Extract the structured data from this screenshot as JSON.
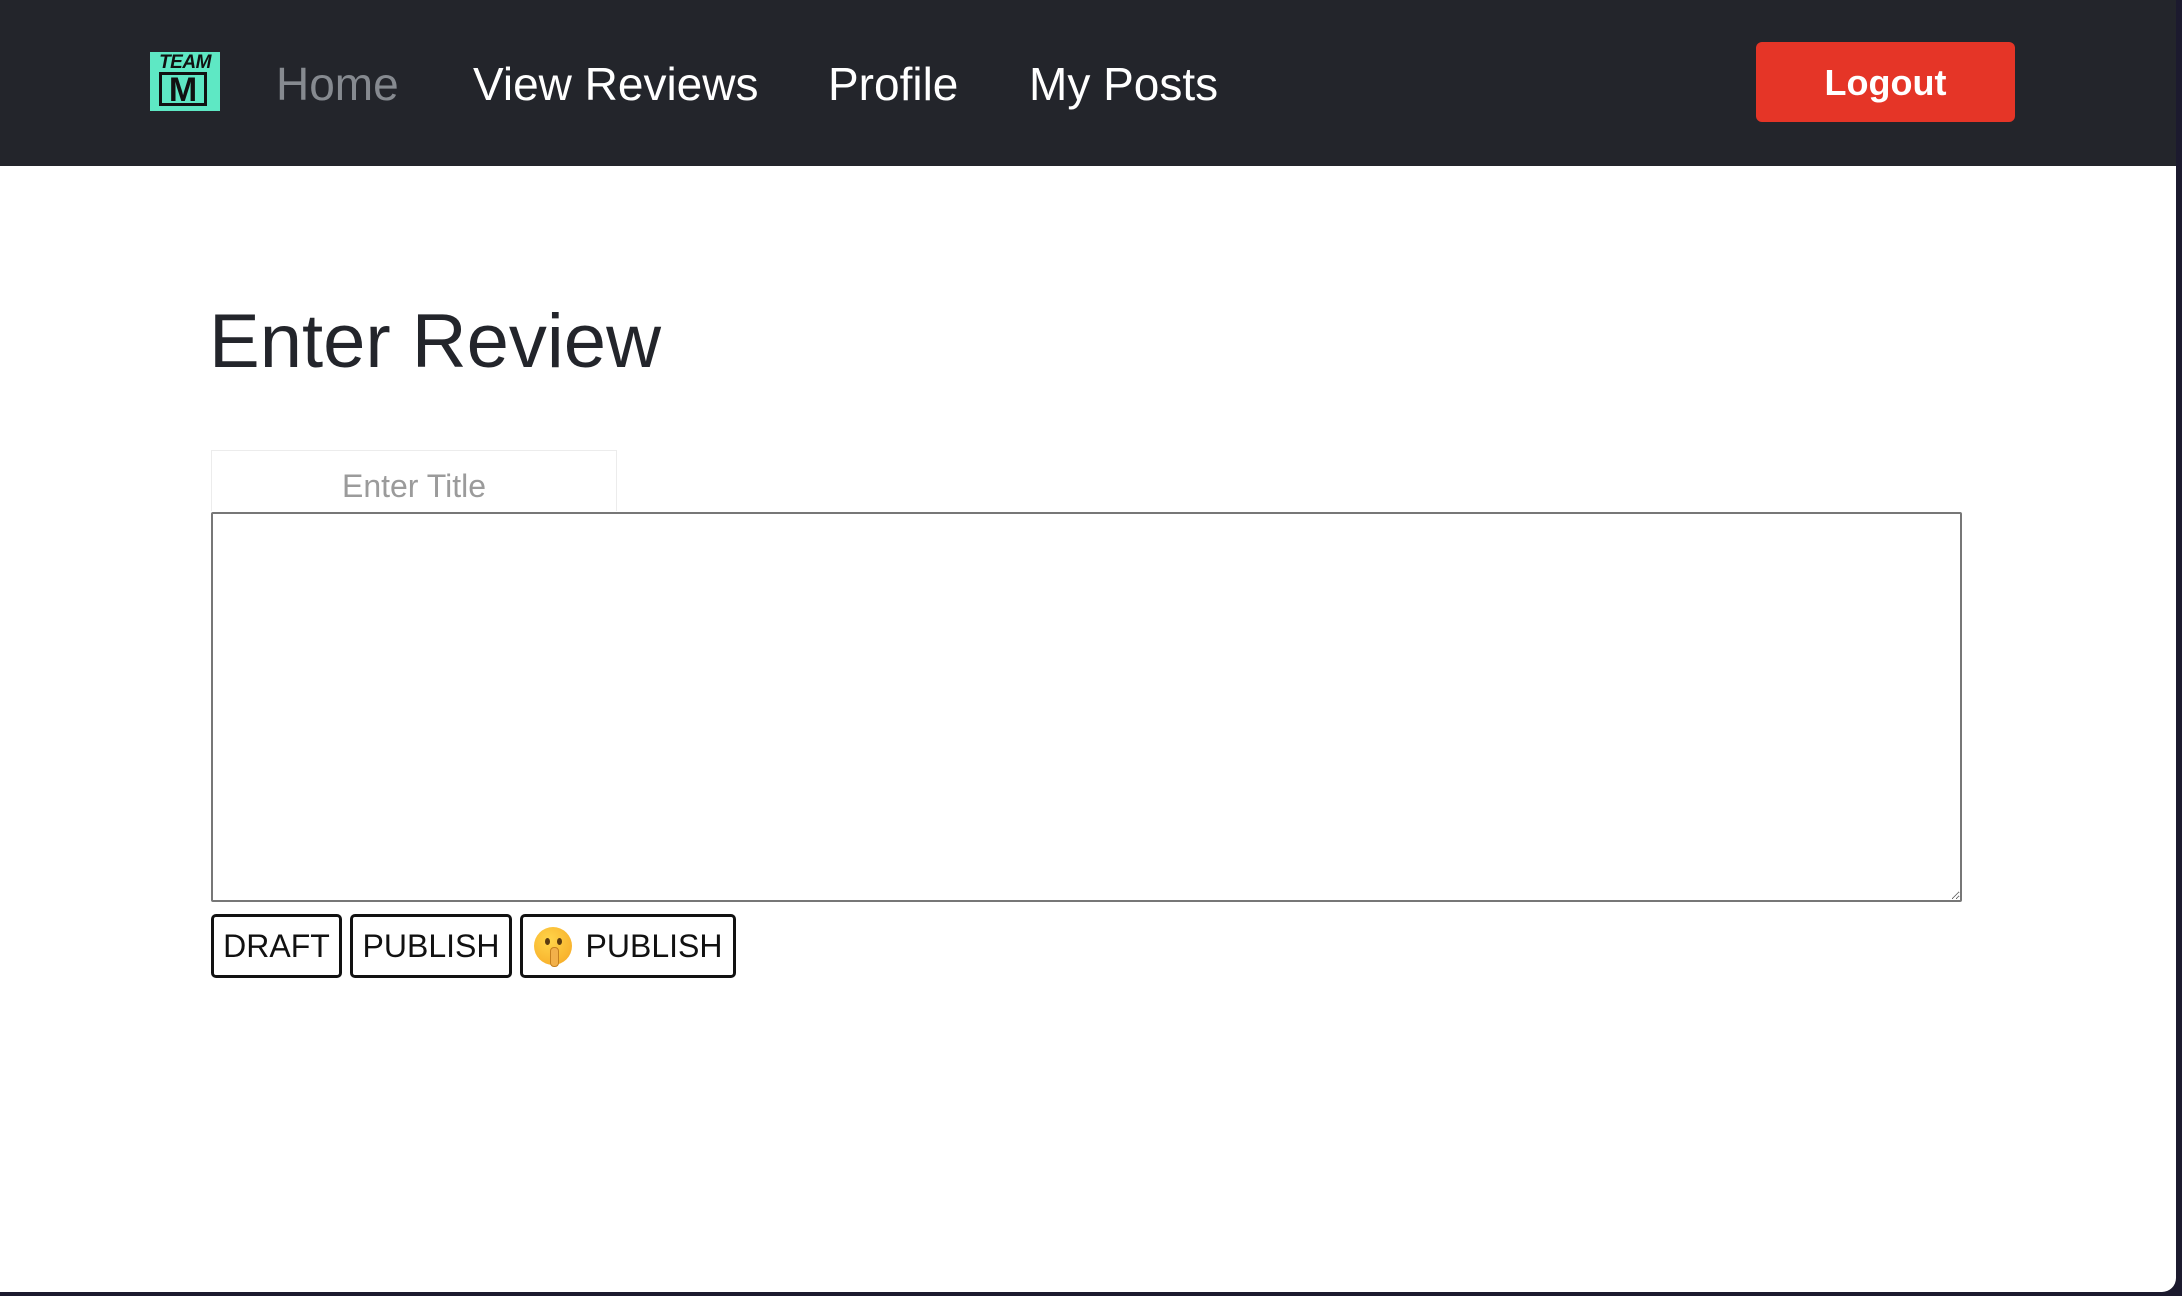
{
  "navbar": {
    "logo": {
      "top_text": "TEAM",
      "letter": "M",
      "brand_color": "#5ee8c4"
    },
    "links": [
      {
        "label": "Home",
        "active": true
      },
      {
        "label": "View Reviews",
        "active": false
      },
      {
        "label": "Profile",
        "active": false
      },
      {
        "label": "My Posts",
        "active": false
      }
    ],
    "logout_label": "Logout",
    "background_color": "#23252b",
    "logout_color": "#e53527"
  },
  "main": {
    "title": "Enter Review",
    "title_input": {
      "placeholder": "Enter Title",
      "value": ""
    },
    "review_textarea": {
      "value": ""
    },
    "buttons": {
      "draft_label": "DRAFT",
      "publish_label": "PUBLISH",
      "secret_publish_label": "PUBLISH",
      "secret_publish_icon": "shushing-face-icon"
    }
  }
}
